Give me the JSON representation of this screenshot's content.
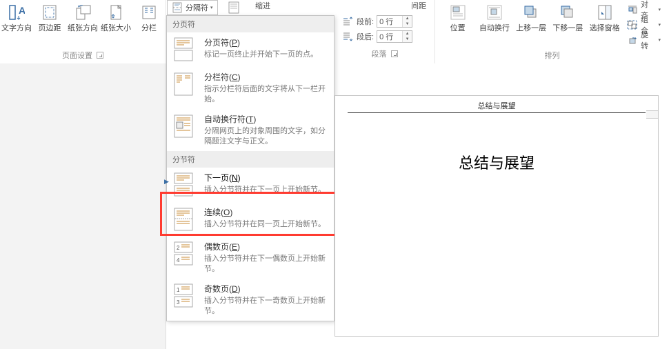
{
  "ribbon": {
    "pageSetup": {
      "textDirection": "文字方向",
      "margins": "页边距",
      "orientation": "纸张方向",
      "size": "纸张大小",
      "columns": "分栏",
      "groupLabel": "页面设置"
    },
    "spacing": {
      "indentLabel": "缩进",
      "spacingLabel": "间距",
      "beforeLabel": "段前:",
      "afterLabel": "段后:",
      "beforeValue": "0 行",
      "afterValue": "0 行",
      "groupLabel": "段落"
    },
    "arrange": {
      "position": "位置",
      "wrap": "自动换行",
      "bringForward": "上移一层",
      "sendBackward": "下移一层",
      "selectionPane": "选择窗格",
      "align": "对齐",
      "group": "组合",
      "rotate": "旋转",
      "groupLabel": "排列"
    }
  },
  "breaksBtn": {
    "label": "分隔符"
  },
  "breaksMenu": {
    "pageBreaksHeader": "分页符",
    "sectionBreaksHeader": "分节符",
    "pageBreak": {
      "title": "分页符(P)",
      "desc": "标记一页终止并开始下一页的点。"
    },
    "columnBreak": {
      "title": "分栏符(C)",
      "desc": "指示分栏符后面的文字将从下一栏开始。"
    },
    "textWrapping": {
      "title": "自动换行符(T)",
      "desc": "分隔网页上的对象周围的文字，如分隔题注文字与正文。"
    },
    "nextPage": {
      "title": "下一页(N)",
      "desc": "插入分节符并在下一页上开始新节。"
    },
    "continuous": {
      "title": "连续(O)",
      "desc": "插入分节符并在同一页上开始新节。"
    },
    "evenPage": {
      "title": "偶数页(E)",
      "desc": "插入分节符并在下一偶数页上开始新节。"
    },
    "oddPage": {
      "title": "奇数页(D)",
      "desc": "插入分节符并在下一奇数页上开始新节。"
    }
  },
  "document": {
    "headerText": "总结与展望",
    "title": "总结与展望"
  }
}
